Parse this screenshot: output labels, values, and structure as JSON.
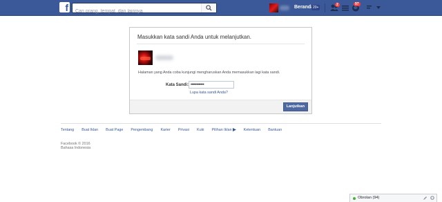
{
  "topbar": {
    "logo": "f",
    "search_placeholder": "Cari orang, tempat, dan lainnya",
    "home_label": "Beranda",
    "home_badge": "20+",
    "friend_requests_count": "2",
    "notifications_count": "97"
  },
  "dialog": {
    "title": "Masukkan kata sandi Anda untuk melanjutkan.",
    "message": "Halaman yang Anda coba kunjungi mengharuskan Anda memasukkan lagi kata sandi.",
    "password_label": "Kata Sandi:",
    "password_value": "••••••••••••",
    "forgot_link": "Lupa kata sandi Anda?",
    "continue_button": "Lanjutkan"
  },
  "footer": {
    "links": [
      "Tentang",
      "Buat Iklan",
      "Buat Page",
      "Pengembang",
      "Karier",
      "Privasi",
      "Kuki",
      "Pilihan Iklan",
      "Ketentuan",
      "Bantuan"
    ],
    "copyright": "Facebook © 2016",
    "language": "Bahasa Indonesia"
  },
  "chat": {
    "label": "Obrolan (94)"
  },
  "colors": {
    "brand": "#3b5998",
    "link": "#365899",
    "button": "#4e69a2",
    "badge": "#fa3e3e",
    "online": "#42b72a"
  }
}
